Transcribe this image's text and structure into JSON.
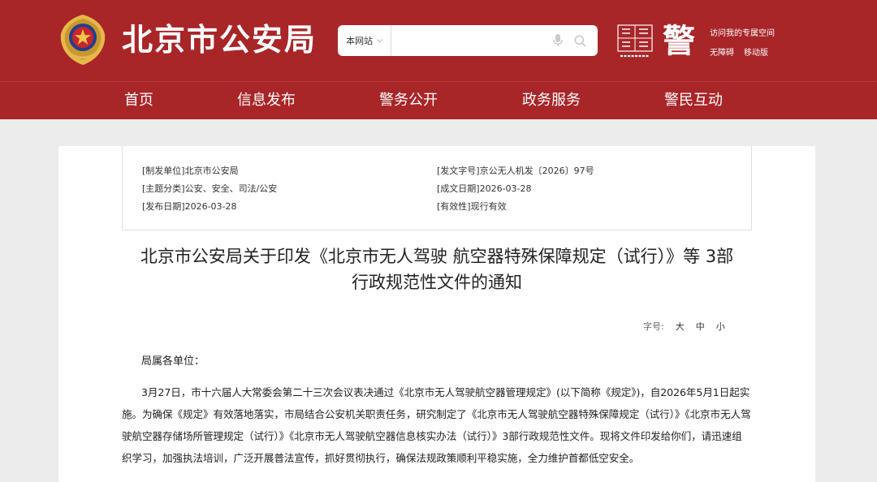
{
  "header": {
    "site_title": "北京市公安局",
    "search": {
      "scope": "本网站",
      "placeholder": ""
    },
    "links": {
      "personal_space": "访问我的专属空间",
      "accessibility": "无障碍",
      "mobile": "移动版"
    },
    "logo_jing": "警",
    "colors": {
      "brand_red": "#a82528",
      "gold": "#e6b84a"
    }
  },
  "nav": {
    "items": [
      {
        "label": "首页"
      },
      {
        "label": "信息发布"
      },
      {
        "label": "警务公开"
      },
      {
        "label": "政务服务"
      },
      {
        "label": "警民互动"
      }
    ]
  },
  "meta": {
    "issuer": "[制发单位]北京市公安局",
    "doc_number": "[发文字号]京公无人机发〔2026〕97号",
    "category": "[主题分类]公安、安全、司法/公安",
    "written_date": "[成文日期]2026-03-28",
    "publish_date": "[发布日期]2026-03-28",
    "validity": "[有效性]现行有效"
  },
  "document": {
    "title_line1": "北京市公安局关于印发《北京市无人驾驶 航空器特殊保障规定（试行）》等 3部",
    "title_line2": "行政规范性文件的通知",
    "font_size": {
      "label": "字号:",
      "large": "大",
      "medium": "中",
      "small": "小"
    },
    "salutation": "局属各单位：",
    "body": "3月27日，市十六届人大常委会第二十三次会议表决通过《北京市无人驾驶航空器管理规定》(以下简称《规定》)，自2026年5月1日起实施。为确保《规定》有效落地落实，市局结合公安机关职责任务，研究制定了《北京市无人驾驶航空器特殊保障规定（试行）》《北京市无人驾驶航空器存储场所管理规定（试行）》《北京市无人驾驶航空器信息核实办法（试行）》3部行政规范性文件。现将文件印发给你们，请迅速组织学习，加强执法培训，广泛开展普法宣传，抓好贯彻执行，确保法规政策顺利平稳实施，全力维护首都低空安全。"
  }
}
